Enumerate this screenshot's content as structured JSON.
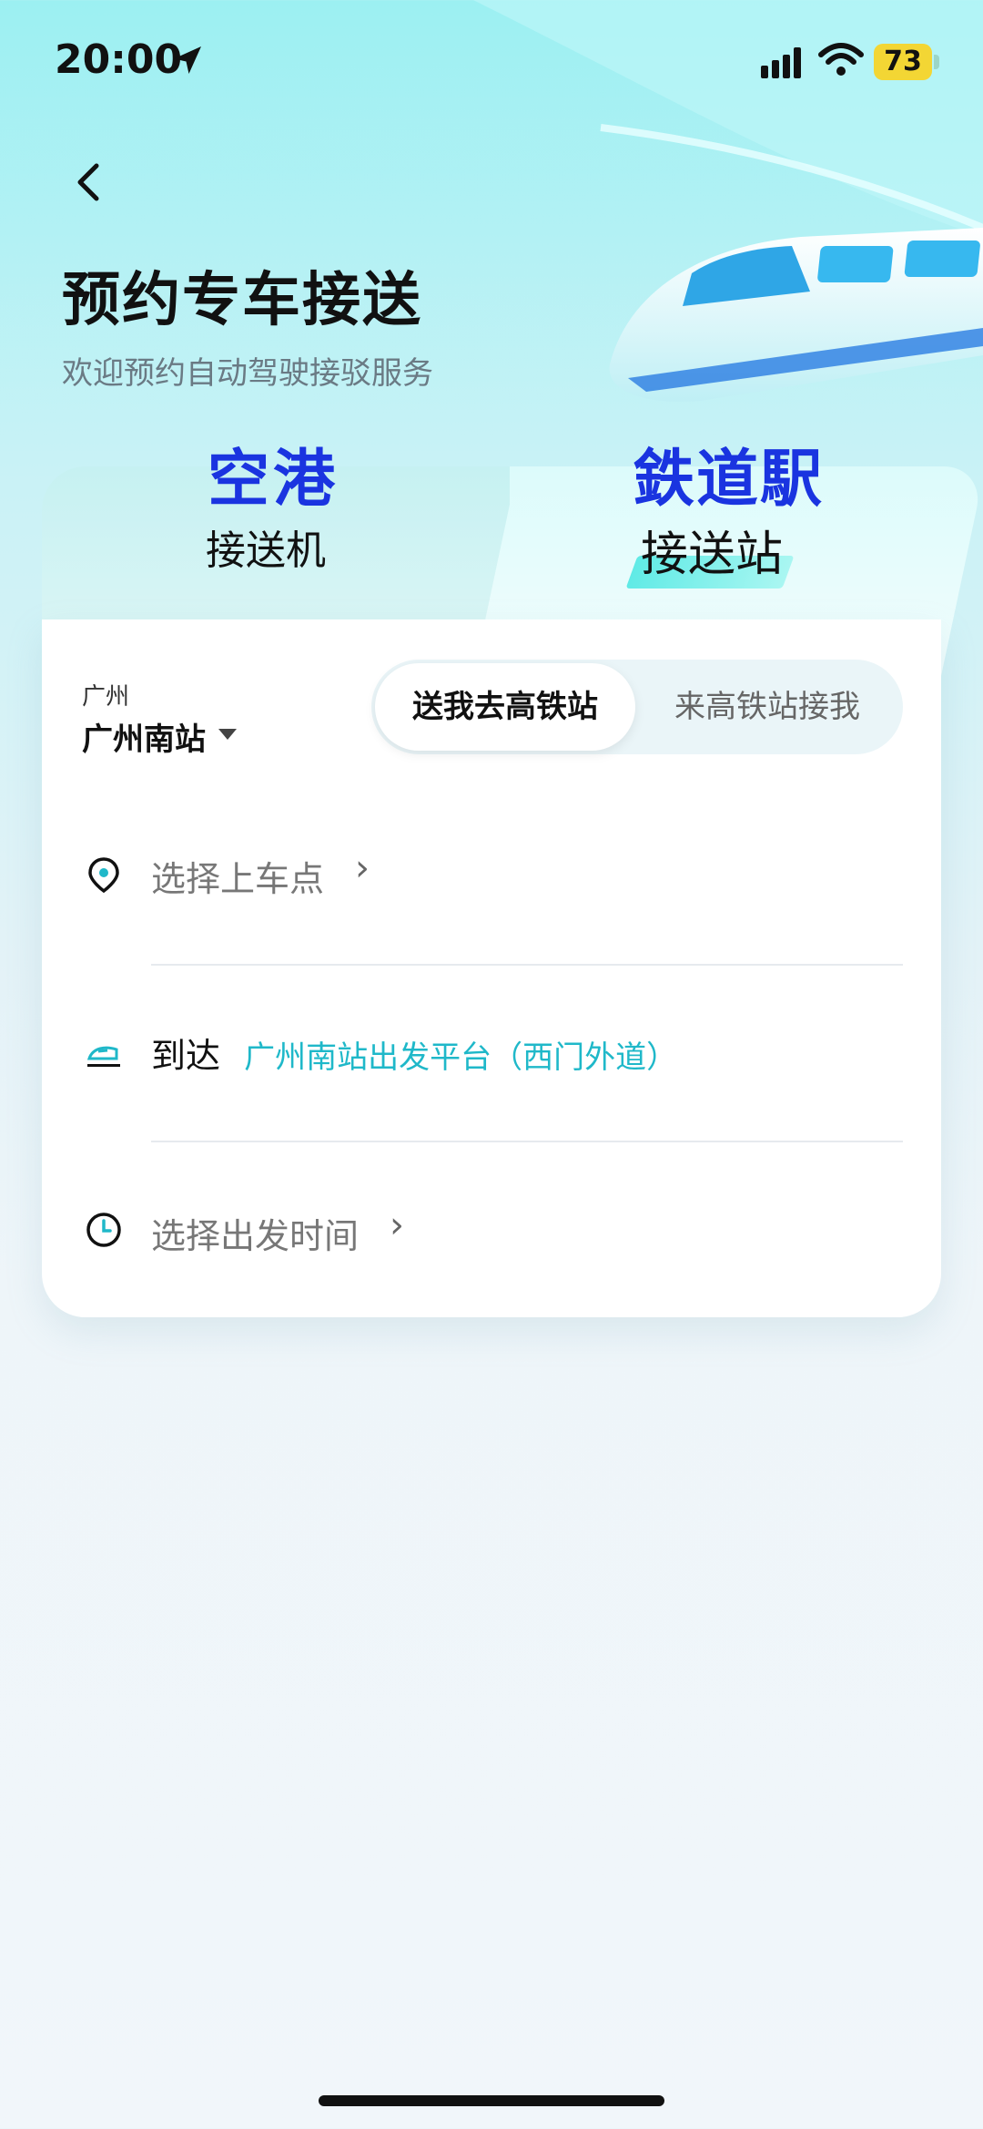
{
  "status_bar": {
    "time": "20:00",
    "battery": "73"
  },
  "header": {
    "title": "预约专车接送",
    "subtitle": "欢迎预约自动驾驶接驳服务"
  },
  "tabs": [
    {
      "title": "空港",
      "label": "接送机",
      "active": false
    },
    {
      "title": "鉄道駅",
      "label": "接送站",
      "active": true
    }
  ],
  "location": {
    "city": "广州",
    "station": "广州南站"
  },
  "mode_toggle": {
    "options": [
      "送我去高铁站",
      "来高铁站接我"
    ],
    "selected": 0
  },
  "form": {
    "pickup_placeholder": "选择上车点",
    "arrive_prefix": "到达",
    "arrive_value": "广州南站出发平台（西门外道）",
    "time_placeholder": "选择出发时间"
  },
  "colors": {
    "accent": "#1fb8c9",
    "tab_title": "#1a34e0"
  }
}
